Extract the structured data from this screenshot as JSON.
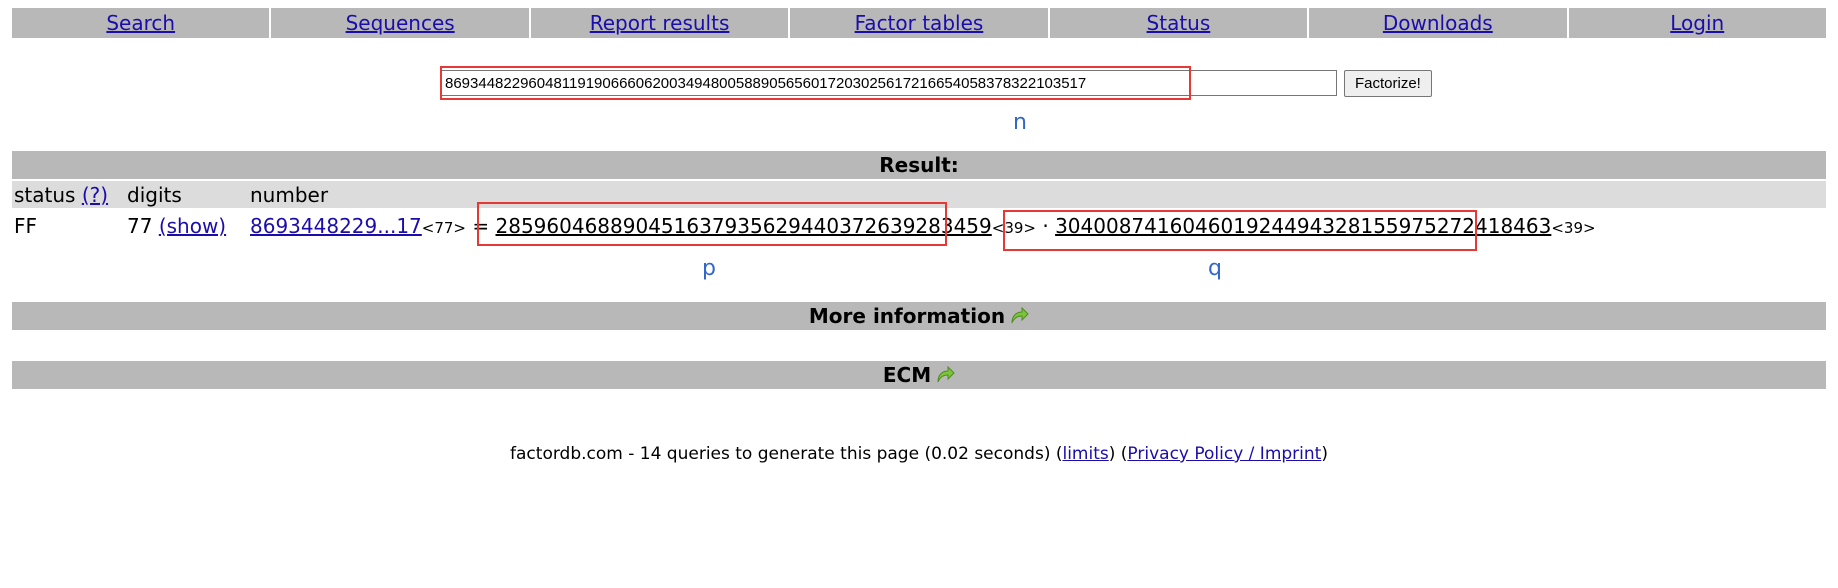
{
  "nav": {
    "items": [
      "Search",
      "Sequences",
      "Report results",
      "Factor tables",
      "Status",
      "Downloads",
      "Login"
    ]
  },
  "search": {
    "value": "86934482296048119190666062003494800588905656017203025617216654058378322103517",
    "button_label": "Factorize!"
  },
  "annotations": {
    "n": "n",
    "p": "p",
    "q": "q"
  },
  "result": {
    "heading": "Result:",
    "columns": {
      "status": "status",
      "status_help": "(?)",
      "digits": "digits",
      "number": "number"
    },
    "row": {
      "status": "FF",
      "digits": "77",
      "show_link": "(show)",
      "number_link": "8693448229...17",
      "number_digits": "<77>",
      "equals": "=",
      "factor1": "285960468890451637935629440372639283459",
      "factor1_digits": "<39>",
      "times": "·",
      "factor2": "304008741604601924494328155975272418463",
      "factor2_digits": "<39>"
    }
  },
  "more_info": {
    "label": "More information"
  },
  "ecm": {
    "label": "ECM"
  },
  "footer": {
    "text_prefix": "factordb.com - 14 queries to generate this page (0.02 seconds) (",
    "limits_link": "limits",
    "text_middle": ") (",
    "privacy_link": "Privacy Policy / Imprint",
    "text_suffix": ")"
  },
  "colors": {
    "annotation_box": "#e53935",
    "annotation_text": "#3366cc",
    "bar_bg": "#b8b8b8",
    "link": "#1a0dab"
  }
}
